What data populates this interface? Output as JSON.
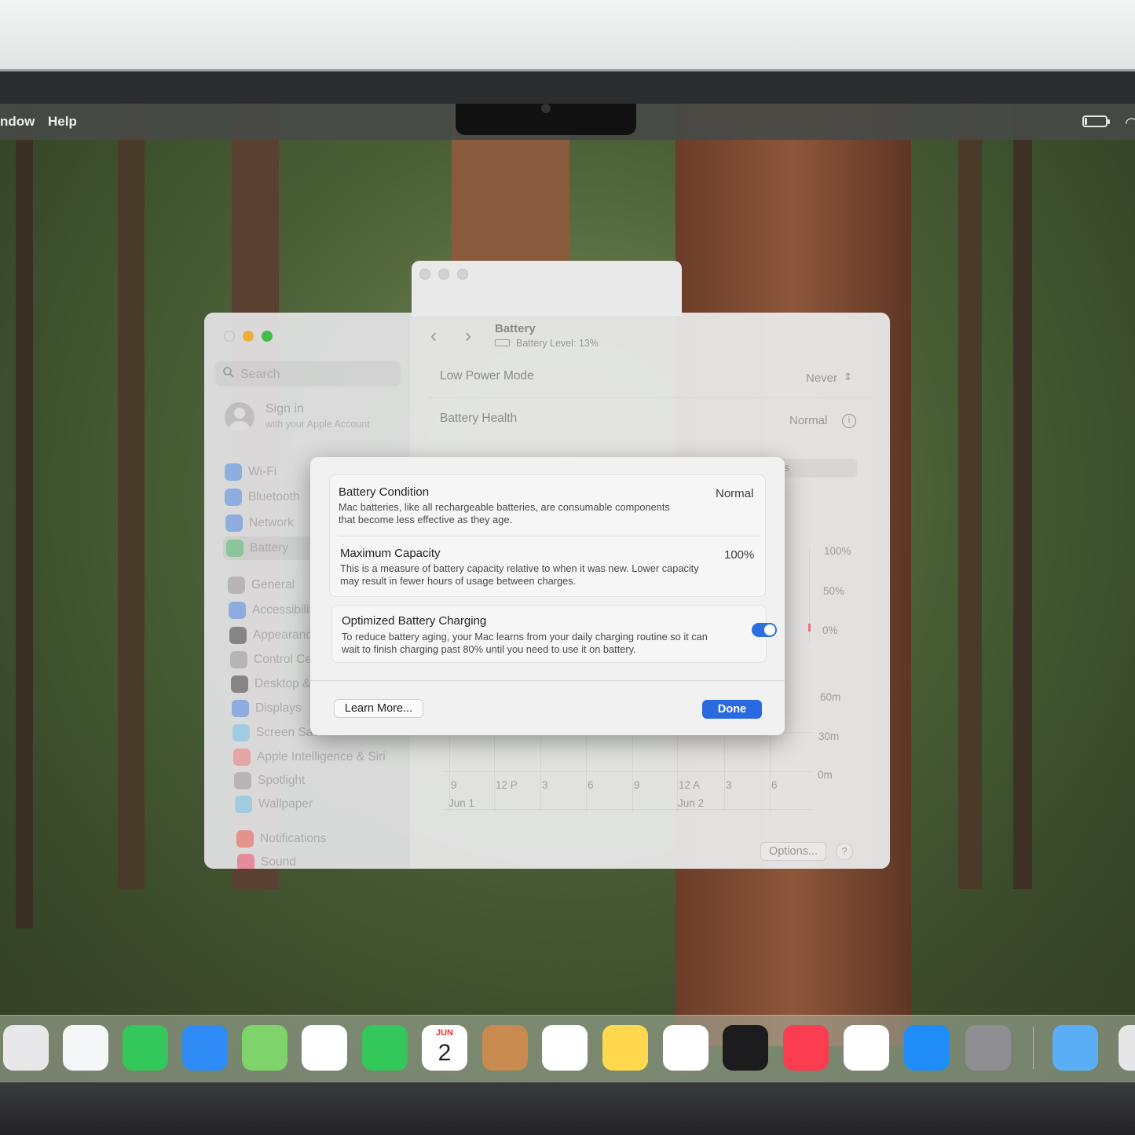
{
  "menubar": {
    "items": [
      "ndow",
      "Help"
    ],
    "battery_level": 0.13
  },
  "settings": {
    "search_placeholder": "Search",
    "account": {
      "title": "Sign in",
      "subtitle": "with your Apple Account"
    },
    "sidebar": [
      {
        "label": "Wi-Fi",
        "icon": "wifi-icon",
        "color": "#2f7cf6"
      },
      {
        "label": "Bluetooth",
        "icon": "bluetooth-icon",
        "color": "#2f7cf6"
      },
      {
        "label": "Network",
        "icon": "globe-icon",
        "color": "#2f7cf6"
      },
      {
        "label": "Battery",
        "icon": "battery-icon",
        "color": "#34c759",
        "active": true
      },
      {
        "label": "General",
        "icon": "gear-icon",
        "color": "#8e8e93"
      },
      {
        "label": "Accessibilit",
        "icon": "accessibility-icon",
        "color": "#2f7cf6"
      },
      {
        "label": "Appearanc",
        "icon": "appearance-icon",
        "color": "#1c1c1e"
      },
      {
        "label": "Control Ce",
        "icon": "control-center-icon",
        "color": "#8e8e93"
      },
      {
        "label": "Desktop &",
        "icon": "desktop-icon",
        "color": "#1c1c1e"
      },
      {
        "label": "Displays",
        "icon": "displays-icon",
        "color": "#2f7cf6"
      },
      {
        "label": "Screen Sav",
        "icon": "screensaver-icon",
        "color": "#5ac8fa"
      },
      {
        "label": "Apple Intelligence & Siri",
        "icon": "siri-icon",
        "color": "#ff6b6b"
      },
      {
        "label": "Spotlight",
        "icon": "spotlight-icon",
        "color": "#8e8e93"
      },
      {
        "label": "Wallpaper",
        "icon": "wallpaper-icon",
        "color": "#5ac8fa"
      },
      {
        "label": "Notifications",
        "icon": "notifications-icon",
        "color": "#ff3b30"
      },
      {
        "label": "Sound",
        "icon": "sound-icon",
        "color": "#ff2d55"
      }
    ],
    "pane": {
      "title": "Battery",
      "subtitle": "Battery Level: 13%",
      "low_power_label": "Low Power Mode",
      "low_power_value": "Never",
      "health_label": "Battery Health",
      "health_value": "Normal",
      "tab_fragment": "s",
      "chart_level_labels": [
        "100%",
        "50%",
        "0%"
      ],
      "chart_time_labels": [
        "60m",
        "30m",
        "0m"
      ],
      "x_labels": [
        "9",
        "12 P",
        "3",
        "6",
        "9",
        "12 A",
        "3",
        "6"
      ],
      "date_labels": [
        "Jun 1",
        "Jun 2"
      ],
      "options_button": "Options...",
      "help_button": "?"
    }
  },
  "dialog": {
    "condition_title": "Battery Condition",
    "condition_value": "Normal",
    "condition_desc": "Mac batteries, like all rechargeable batteries, are consumable components that become less effective as they age.",
    "capacity_title": "Maximum Capacity",
    "capacity_value": "100%",
    "capacity_desc": "This is a measure of battery capacity relative to when it was new. Lower capacity may result in fewer hours of usage between charges.",
    "optimized_title": "Optimized Battery Charging",
    "optimized_desc": "To reduce battery aging, your Mac learns from your daily charging routine so it can wait to finish charging past 80% until you need to use it on battery.",
    "optimized_enabled": true,
    "learn_more": "Learn More...",
    "done": "Done"
  },
  "dock": {
    "calendar_month": "JUN",
    "calendar_day": "2",
    "apps": [
      {
        "name": "launchpad-icon",
        "color": "#e8e8ea"
      },
      {
        "name": "safari-icon",
        "color": "#f4f6f8"
      },
      {
        "name": "messages-icon",
        "color": "#34c759"
      },
      {
        "name": "mail-icon",
        "color": "#2f8cf6"
      },
      {
        "name": "maps-icon",
        "color": "#7fd36b"
      },
      {
        "name": "photos-icon",
        "color": "#ffffff"
      },
      {
        "name": "facetime-icon",
        "color": "#34c759"
      },
      {
        "name": "calendar-icon",
        "color": "#ffffff"
      },
      {
        "name": "contacts-icon",
        "color": "#c98a4f"
      },
      {
        "name": "reminders-icon",
        "color": "#ffffff"
      },
      {
        "name": "notes-icon",
        "color": "#ffd84d"
      },
      {
        "name": "freeform-icon",
        "color": "#ffffff"
      },
      {
        "name": "tv-icon",
        "color": "#1c1c1e"
      },
      {
        "name": "music-icon",
        "color": "#fa3d4f"
      },
      {
        "name": "news-icon",
        "color": "#ffffff"
      },
      {
        "name": "app-store-icon",
        "color": "#1f8cf8"
      },
      {
        "name": "system-settings-icon",
        "color": "#8e8e93"
      },
      {
        "name": "downloads-folder-icon",
        "color": "#5aaef5"
      },
      {
        "name": "trash-icon",
        "color": "#e6e6e8"
      }
    ]
  }
}
